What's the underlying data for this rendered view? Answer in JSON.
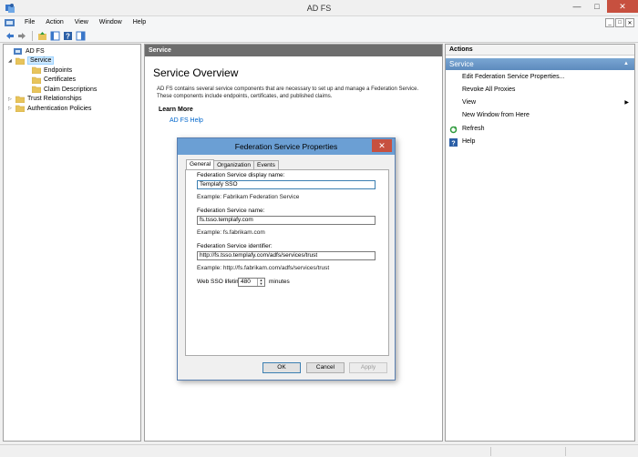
{
  "window": {
    "title": "AD FS"
  },
  "menu": [
    "File",
    "Action",
    "View",
    "Window",
    "Help"
  ],
  "tree": [
    {
      "label": "AD FS",
      "indent": 0,
      "expander": "",
      "selected": false
    },
    {
      "label": "Service",
      "indent": 1,
      "expander": "◢",
      "selected": true
    },
    {
      "label": "Endpoints",
      "indent": 2,
      "expander": "",
      "selected": false
    },
    {
      "label": "Certificates",
      "indent": 2,
      "expander": "",
      "selected": false
    },
    {
      "label": "Claim Descriptions",
      "indent": 2,
      "expander": "",
      "selected": false
    },
    {
      "label": "Trust Relationships",
      "indent": 1,
      "expander": "▷",
      "selected": false
    },
    {
      "label": "Authentication Policies",
      "indent": 1,
      "expander": "▷",
      "selected": false
    }
  ],
  "center": {
    "header": "Service",
    "title": "Service Overview",
    "description": "AD FS contains several service components that are necessary to set up and manage a Federation Service. These components include endpoints, certificates, and published claims.",
    "learn_more": "Learn More",
    "help_link": "AD FS Help"
  },
  "actions": {
    "header": "Actions",
    "section": "Service",
    "items": [
      {
        "label": "Edit Federation Service Properties...",
        "icon": "",
        "submenu": false
      },
      {
        "label": "Revoke All Proxies",
        "icon": "",
        "submenu": false
      },
      {
        "label": "View",
        "icon": "",
        "submenu": true
      },
      {
        "label": "New Window from Here",
        "icon": "",
        "submenu": false
      },
      {
        "label": "Refresh",
        "icon": "refresh-icon",
        "submenu": false
      },
      {
        "label": "Help",
        "icon": "help-icon",
        "submenu": false
      }
    ]
  },
  "dialog": {
    "title": "Federation Service Properties",
    "tabs": [
      "General",
      "Organization",
      "Events"
    ],
    "active_tab": "General",
    "display_name_label": "Federation Service display name:",
    "display_name_value": "Templafy SSO",
    "display_name_example": "Example: Fabrikam Federation Service",
    "service_name_label": "Federation Service name:",
    "service_name_value": "fs.tsso.templafy.com",
    "service_name_example": "Example: fs.fabrikam.com",
    "identifier_label": "Federation Service identifier:",
    "identifier_value": "http://fs.tsso.templafy.com/adfs/services/trust",
    "identifier_example": "Example: http://fs.fabrikam.com/adfs/services/trust",
    "sso_label": "Web SSO lifetime:",
    "sso_value": "480",
    "sso_unit": "minutes",
    "ok": "OK",
    "cancel": "Cancel",
    "apply": "Apply"
  }
}
